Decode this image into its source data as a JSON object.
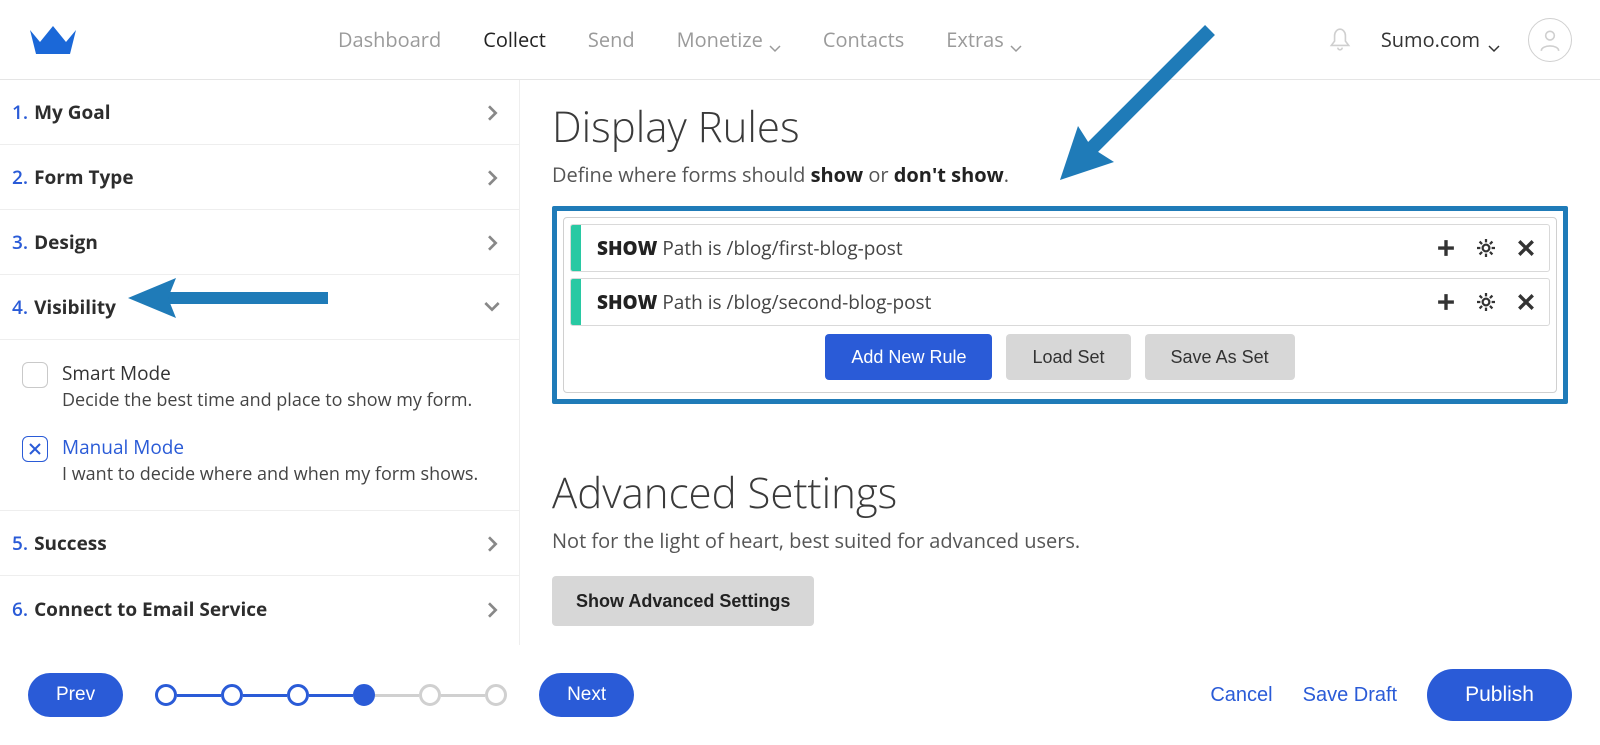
{
  "nav": {
    "items": [
      {
        "label": "Dashboard",
        "active": false,
        "caret": false
      },
      {
        "label": "Collect",
        "active": true,
        "caret": false
      },
      {
        "label": "Send",
        "active": false,
        "caret": false
      },
      {
        "label": "Monetize",
        "active": false,
        "caret": true
      },
      {
        "label": "Contacts",
        "active": false,
        "caret": false
      },
      {
        "label": "Extras",
        "active": false,
        "caret": true
      }
    ],
    "account": "Sumo.com"
  },
  "sidebar": {
    "steps": [
      {
        "num": "1.",
        "label": "My Goal"
      },
      {
        "num": "2.",
        "label": "Form Type"
      },
      {
        "num": "3.",
        "label": "Design"
      },
      {
        "num": "4.",
        "label": "Visibility"
      },
      {
        "num": "5.",
        "label": "Success"
      },
      {
        "num": "6.",
        "label": "Connect to Email Service"
      }
    ],
    "modes": {
      "smart": {
        "title": "Smart Mode",
        "desc": "Decide the best time and place to show my form."
      },
      "manual": {
        "title": "Manual Mode",
        "desc": "I want to decide where and when my form shows."
      }
    }
  },
  "content": {
    "display_rules": {
      "title": "Display Rules",
      "subtitle_prefix": "Define where forms should ",
      "subtitle_bold1": "show",
      "subtitle_mid": " or ",
      "subtitle_bold2": "don't show",
      "subtitle_end": ".",
      "rules": [
        {
          "keyword": "SHOW",
          "text": "Path is /blog/first-blog-post"
        },
        {
          "keyword": "SHOW",
          "text": "Path is /blog/second-blog-post"
        }
      ],
      "buttons": {
        "add": "Add New Rule",
        "load": "Load Set",
        "save": "Save As Set"
      }
    },
    "advanced": {
      "title": "Advanced Settings",
      "subtitle": "Not for the light of heart, best suited for advanced users.",
      "button": "Show Advanced Settings"
    }
  },
  "footer": {
    "prev": "Prev",
    "next": "Next",
    "cancel": "Cancel",
    "save_draft": "Save Draft",
    "publish": "Publish",
    "progress_current": 4,
    "progress_total": 6
  }
}
